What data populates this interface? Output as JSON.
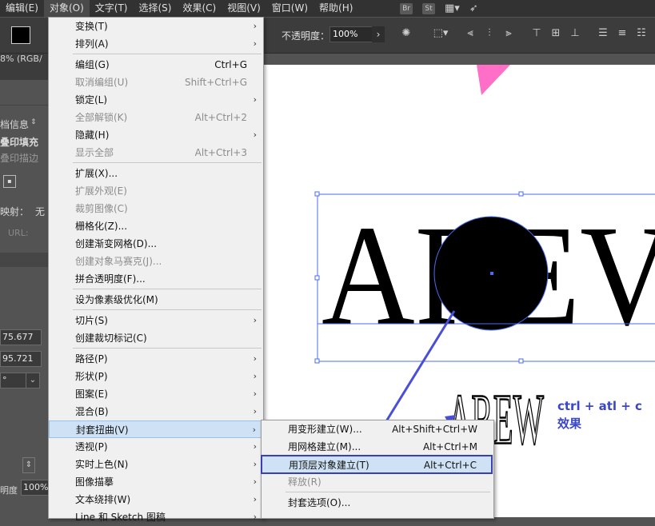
{
  "menubar": {
    "items": [
      "编辑(E)",
      "对象(O)",
      "文字(T)",
      "选择(S)",
      "效果(C)",
      "视图(V)",
      "窗口(W)",
      "帮助(H)"
    ],
    "active_index": 1,
    "icons": [
      "Br",
      "St"
    ]
  },
  "controlbar": {
    "fill_color": "#000000",
    "opacity_label": "不透明度：",
    "opacity_value": "100%"
  },
  "leftpanel": {
    "doc_mode": "8% (RGB/",
    "doc_info": "档信息",
    "overprint_fill": "叠印填充",
    "overprint_stroke": "叠印描边",
    "mapping_label": "映射：",
    "mapping_value": "无",
    "url_label": "URL:",
    "x_value": "75.677",
    "y_value": "95.721",
    "angle_value": "°",
    "opacity_label": "明度",
    "opacity_value": "100%"
  },
  "object_menu": {
    "items": [
      {
        "label": "变换(T)",
        "shortcut": "",
        "submenu": true,
        "disabled": false
      },
      {
        "label": "排列(A)",
        "shortcut": "",
        "submenu": true,
        "disabled": false
      },
      {
        "label": "编组(G)",
        "shortcut": "Ctrl+G",
        "submenu": false,
        "disabled": false
      },
      {
        "label": "取消编组(U)",
        "shortcut": "Shift+Ctrl+G",
        "submenu": false,
        "disabled": true
      },
      {
        "label": "锁定(L)",
        "shortcut": "",
        "submenu": true,
        "disabled": false
      },
      {
        "label": "全部解锁(K)",
        "shortcut": "Alt+Ctrl+2",
        "submenu": false,
        "disabled": true
      },
      {
        "label": "隐藏(H)",
        "shortcut": "",
        "submenu": true,
        "disabled": false
      },
      {
        "label": "显示全部",
        "shortcut": "Alt+Ctrl+3",
        "submenu": false,
        "disabled": true
      },
      {
        "label": "扩展(X)...",
        "shortcut": "",
        "submenu": false,
        "disabled": false
      },
      {
        "label": "扩展外观(E)",
        "shortcut": "",
        "submenu": false,
        "disabled": true
      },
      {
        "label": "裁剪图像(C)",
        "shortcut": "",
        "submenu": false,
        "disabled": true
      },
      {
        "label": "栅格化(Z)...",
        "shortcut": "",
        "submenu": false,
        "disabled": false
      },
      {
        "label": "创建渐变网格(D)...",
        "shortcut": "",
        "submenu": false,
        "disabled": false
      },
      {
        "label": "创建对象马赛克(J)...",
        "shortcut": "",
        "submenu": false,
        "disabled": true
      },
      {
        "label": "拼合透明度(F)...",
        "shortcut": "",
        "submenu": false,
        "disabled": false
      },
      {
        "label": "设为像素级优化(M)",
        "shortcut": "",
        "submenu": false,
        "disabled": false
      },
      {
        "label": "切片(S)",
        "shortcut": "",
        "submenu": true,
        "disabled": false
      },
      {
        "label": "创建裁切标记(C)",
        "shortcut": "",
        "submenu": false,
        "disabled": false
      },
      {
        "label": "路径(P)",
        "shortcut": "",
        "submenu": true,
        "disabled": false
      },
      {
        "label": "形状(P)",
        "shortcut": "",
        "submenu": true,
        "disabled": false
      },
      {
        "label": "图案(E)",
        "shortcut": "",
        "submenu": true,
        "disabled": false
      },
      {
        "label": "混合(B)",
        "shortcut": "",
        "submenu": true,
        "disabled": false
      },
      {
        "label": "封套扭曲(V)",
        "shortcut": "",
        "submenu": true,
        "disabled": false
      },
      {
        "label": "透视(P)",
        "shortcut": "",
        "submenu": true,
        "disabled": false
      },
      {
        "label": "实时上色(N)",
        "shortcut": "",
        "submenu": true,
        "disabled": false
      },
      {
        "label": "图像描摹",
        "shortcut": "",
        "submenu": true,
        "disabled": false
      },
      {
        "label": "文本绕排(W)",
        "shortcut": "",
        "submenu": true,
        "disabled": false
      },
      {
        "label": "Line 和 Sketch 图稿",
        "shortcut": "",
        "submenu": true,
        "disabled": false
      }
    ],
    "highlighted_index": 22
  },
  "envelope_submenu": {
    "items": [
      {
        "label": "用变形建立(W)...",
        "shortcut": "Alt+Shift+Ctrl+W",
        "disabled": false
      },
      {
        "label": "用网格建立(M)...",
        "shortcut": "Alt+Ctrl+M",
        "disabled": false
      },
      {
        "label": "用顶层对象建立(T)",
        "shortcut": "Alt+Ctrl+C",
        "disabled": false
      },
      {
        "label": "释放(R)",
        "shortcut": "",
        "disabled": true
      },
      {
        "label": "封套选项(O)...",
        "shortcut": "",
        "disabled": false
      }
    ],
    "highlighted_index": 2
  },
  "canvas": {
    "word": "AREV",
    "warped_word": "AREW",
    "circle_color": "#000000",
    "selection_color": "#4a6cf0",
    "accent_pink": "#ff6ec7"
  },
  "annotation": {
    "line1": "ctrl + atl + c",
    "line2": "效果",
    "color": "#3b47c6"
  }
}
